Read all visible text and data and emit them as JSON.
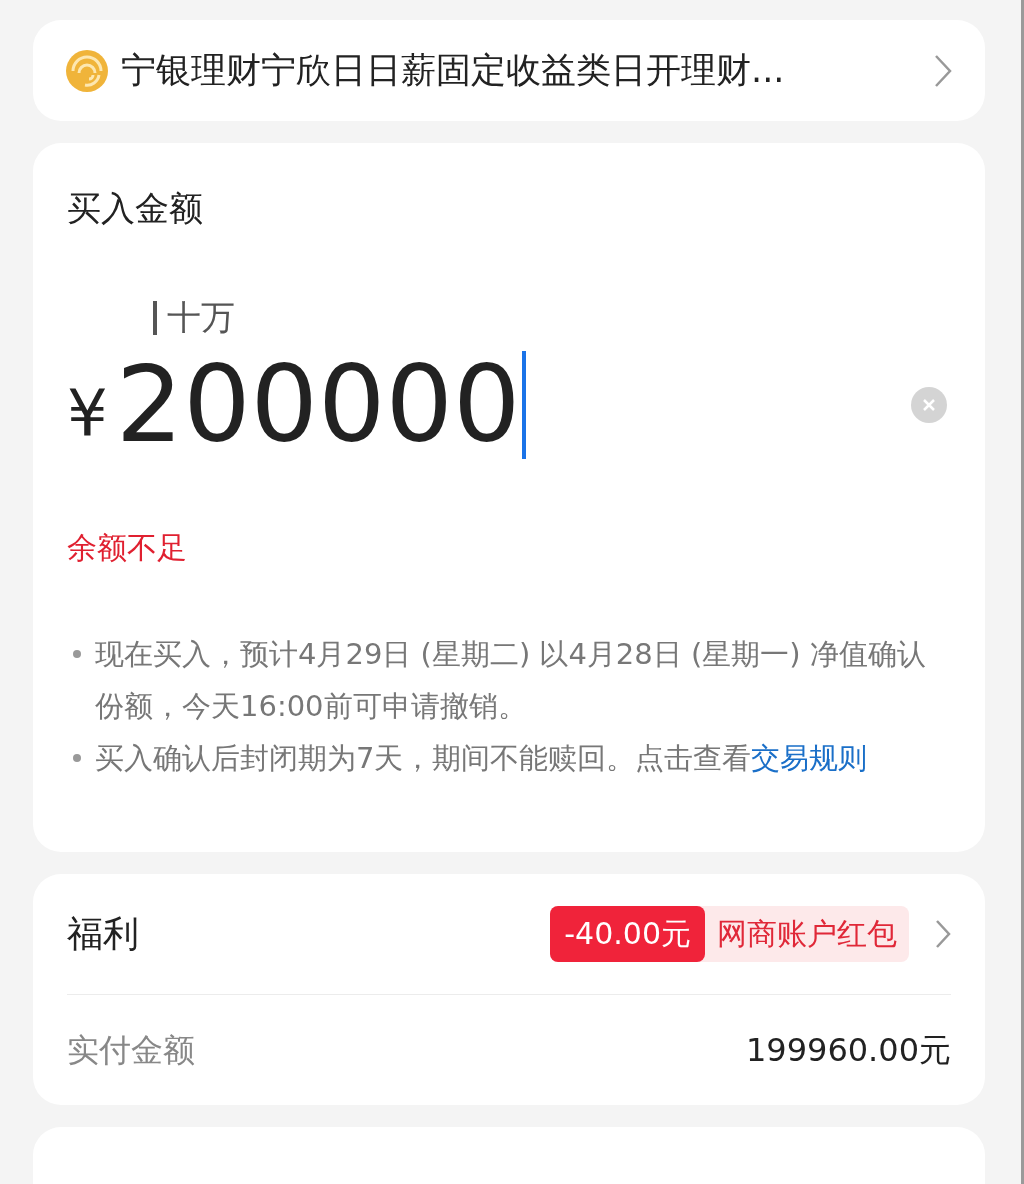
{
  "product": {
    "name": "宁银理财宁欣日日薪固定收益类日开理财..."
  },
  "purchase": {
    "title": "买入金额",
    "unit_hint": "十万",
    "currency": "¥",
    "amount": "200000",
    "error": "余额不足",
    "notes": [
      {
        "text": "现在买入，预计4月29日 (星期二) 以4月28日 (星期一) 净值确认份额，今天16:00前可申请撤销。"
      },
      {
        "text": "买入确认后封闭期为7天，期间不能赎回。点击查看",
        "link": "交易规则"
      }
    ]
  },
  "benefits": {
    "label": "福利",
    "discount": "-40.00元",
    "coupon": "网商账户红包",
    "paid_label": "实付金额",
    "paid_value": "199960.00元"
  }
}
